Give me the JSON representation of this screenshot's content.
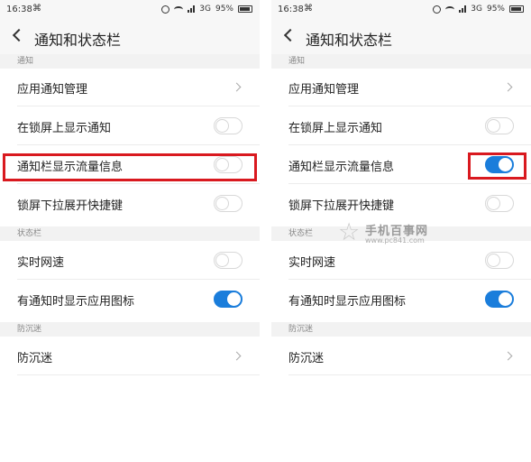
{
  "status_bar": {
    "time": "16:38",
    "network": "3G",
    "battery": "95%"
  },
  "header": {
    "title": "通知和状态栏"
  },
  "sections": {
    "notifications": "通知",
    "status_bar": "状态栏",
    "anti_addiction": "防沉迷"
  },
  "items": {
    "app_notification_mgmt": "应用通知管理",
    "lockscreen_notifications": "在锁屏上显示通知",
    "traffic_info": "通知栏显示流量信息",
    "lockscreen_shortcuts": "锁屏下拉展开快捷键",
    "realtime_speed": "实时网速",
    "app_icon_on_notify": "有通知时显示应用图标",
    "anti_addiction": "防沉迷"
  },
  "toggles": {
    "left": {
      "lockscreen_notifications": false,
      "traffic_info": false,
      "lockscreen_shortcuts": false,
      "realtime_speed": false,
      "app_icon_on_notify": true
    },
    "right": {
      "lockscreen_notifications": false,
      "traffic_info": true,
      "lockscreen_shortcuts": false,
      "realtime_speed": false,
      "app_icon_on_notify": true
    }
  },
  "colors": {
    "toggle_on": "#1a7ddb",
    "highlight": "#d9191f"
  },
  "watermark": {
    "title": "手机百事网",
    "url": "www.pc841.com"
  }
}
